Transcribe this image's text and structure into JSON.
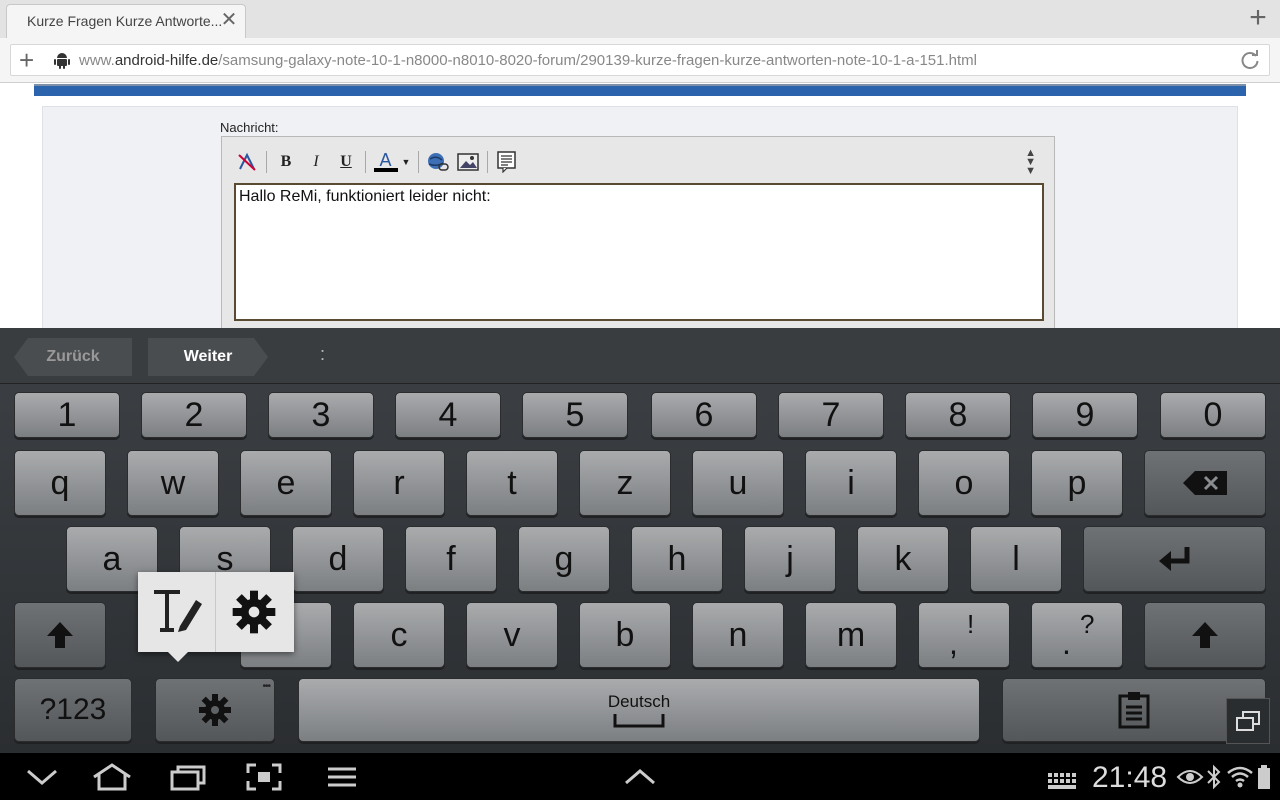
{
  "browser": {
    "tab_title": "Kurze Fragen Kurze Antworte...",
    "url_prefix": "www.",
    "url_domain": "android-hilfe.de",
    "url_path": "/samsung-galaxy-note-10-1-n8000-n8010-8020-forum/290139-kurze-fragen-kurze-antworten-note-10-1-a-151.html"
  },
  "editor": {
    "label": "Nachricht:",
    "text": "Hallo ReMi, funktioniert leider nicht:",
    "toolbar": {
      "bold": "B",
      "italic": "I",
      "underline": "U",
      "font_color": "A"
    }
  },
  "keyboard": {
    "back_label": "Zurück",
    "next_label": "Weiter",
    "suggestion": ":",
    "number_row": [
      "1",
      "2",
      "3",
      "4",
      "5",
      "6",
      "7",
      "8",
      "9",
      "0"
    ],
    "row1": [
      "q",
      "w",
      "e",
      "r",
      "t",
      "z",
      "u",
      "i",
      "o",
      "p"
    ],
    "row2": [
      "a",
      "s",
      "d",
      "f",
      "g",
      "h",
      "j",
      "k",
      "l"
    ],
    "row3": [
      "c",
      "v",
      "b",
      "n",
      "m"
    ],
    "comma_main": ",",
    "comma_alt": "!",
    "period_main": ".",
    "period_alt": "?",
    "symbols_label": "?123",
    "space_label": "Deutsch"
  },
  "status": {
    "time": "21:48"
  },
  "colors": {
    "blue_bar": "#2b63ad",
    "keyboard_bg": "#2b2e31",
    "key_face": "#a9abad"
  }
}
